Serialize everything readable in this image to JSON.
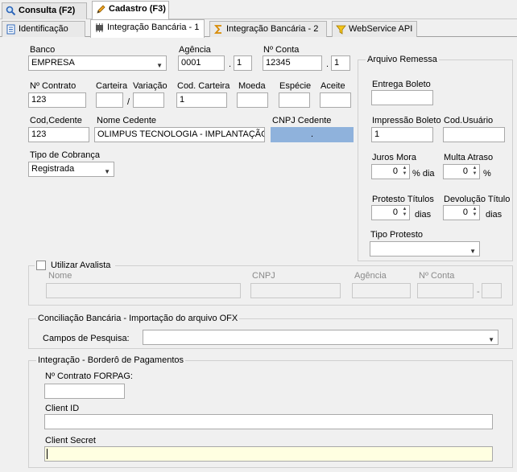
{
  "tabs_top": [
    {
      "label": "Consulta (F2)"
    },
    {
      "label": "Cadastro (F3)"
    }
  ],
  "tabs_sub": [
    {
      "label": "Identificação"
    },
    {
      "label": "Integração Bancária - 1"
    },
    {
      "label": "Integração Bancária - 2"
    },
    {
      "label": "WebService API"
    }
  ],
  "form": {
    "banco_label": "Banco",
    "banco_value": "EMPRESA",
    "agencia_label": "Agência",
    "agencia_value": "0001",
    "agencia_dig": "1",
    "conta_label": "Nº Conta",
    "conta_value": "12345",
    "conta_dig": "1",
    "contrato_label": "Nº Contrato",
    "contrato_value": "123",
    "carteira_label": "Carteira",
    "variacao_label": "Variação",
    "slash": "/",
    "cod_carteira_label": "Cod. Carteira",
    "cod_carteira_value": "1",
    "moeda_label": "Moeda",
    "especie_label": "Espécie",
    "aceite_label": "Aceite",
    "cod_cedente_label": "Cod,Cedente",
    "cod_cedente_value": "123",
    "nome_cedente_label": "Nome Cedente",
    "nome_cedente_value": "OLIMPUS TECNOLOGIA - IMPLANTAÇÃO",
    "cnpj_cedente_label": "CNPJ Cedente",
    "cnpj_cedente_value": ".",
    "tipo_cobranca_label": "Tipo de Cobrança",
    "tipo_cobranca_value": "Registrada",
    "dot": "."
  },
  "arquivo_remessa": {
    "title": "Arquivo Remessa",
    "entrega_boleto_label": "Entrega Boleto",
    "impressao_boleto_label": "Impressão Boleto",
    "impressao_boleto_value": "1",
    "cod_usuario_label": "Cod.Usuário",
    "juros_mora_label": "Juros Mora",
    "juros_mora_value": "0",
    "juros_unit": "% dia",
    "multa_atraso_label": "Multa Atraso",
    "multa_atraso_value": "0",
    "multa_unit": "%",
    "protesto_titulos_label": "Protesto Títulos",
    "protesto_value": "0",
    "protesto_unit": "dias",
    "devolucao_titulo_label": "Devolução Título",
    "devolucao_value": "0",
    "devolucao_unit": "dias",
    "tipo_protesto_label": "Tipo Protesto"
  },
  "avalista": {
    "title": "Utilizar Avalista",
    "nome_label": "Nome",
    "cnpj_label": "CNPJ",
    "agencia_label": "Agência",
    "conta_label": "Nº Conta",
    "dash": "-"
  },
  "conciliacao": {
    "title": "Conciliação Bancária - Importação do arquivo OFX",
    "campos_label": "Campos de Pesquisa:"
  },
  "bordero": {
    "title": "Integração - Borderô de Pagamentos",
    "contrato_label": "Nº Contrato FORPAG:",
    "client_id_label": "Client ID",
    "client_secret_label": "Client Secret"
  },
  "colors": {
    "cnpj_field": "#8fb2dc",
    "secret_field": "#ffffe1"
  }
}
